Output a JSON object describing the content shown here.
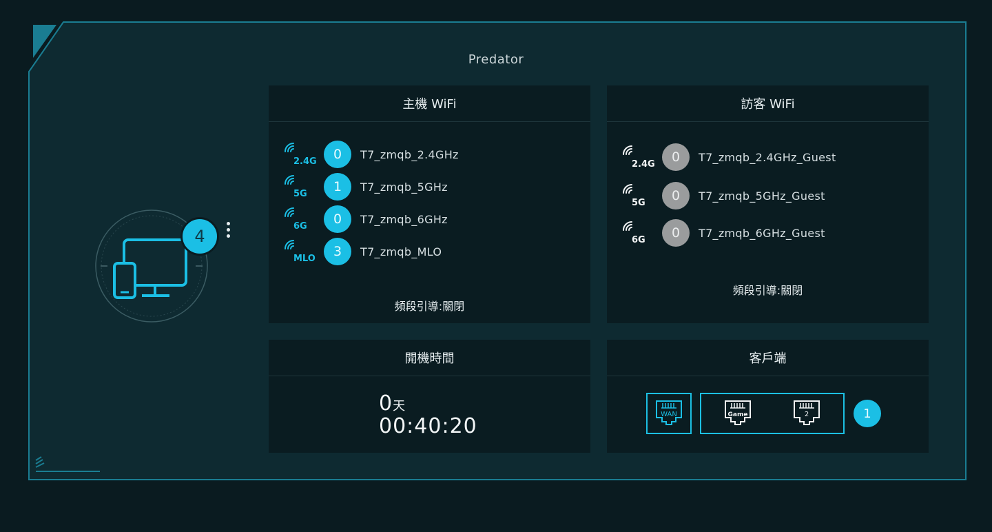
{
  "app": {
    "title": "Predator"
  },
  "devices": {
    "count": "4"
  },
  "main_wifi": {
    "title": "主機 WiFi",
    "networks": [
      {
        "band": "2.4G",
        "count": "0",
        "ssid": "T7_zmqb_2.4GHz"
      },
      {
        "band": "5G",
        "count": "1",
        "ssid": "T7_zmqb_5GHz"
      },
      {
        "band": "6G",
        "count": "0",
        "ssid": "T7_zmqb_6GHz"
      },
      {
        "band": "MLO",
        "count": "3",
        "ssid": "T7_zmqb_MLO"
      }
    ],
    "band_steering": "頻段引導:關閉"
  },
  "guest_wifi": {
    "title": "訪客 WiFi",
    "networks": [
      {
        "band": "2.4G",
        "count": "0",
        "ssid": "T7_zmqb_2.4GHz_Guest"
      },
      {
        "band": "5G",
        "count": "0",
        "ssid": "T7_zmqb_5GHz_Guest"
      },
      {
        "band": "6G",
        "count": "0",
        "ssid": "T7_zmqb_6GHz_Guest"
      }
    ],
    "band_steering": "頻段引導:關閉"
  },
  "uptime": {
    "title": "開機時間",
    "days": "0",
    "days_unit": "天",
    "time": "00:40:20"
  },
  "clients": {
    "title": "客戶端",
    "ports": [
      {
        "label": "WAN",
        "icon": "ethernet-port-icon"
      },
      {
        "label": "Game",
        "icon": "ethernet-port-icon"
      },
      {
        "label": "2",
        "icon": "ethernet-port-icon"
      }
    ],
    "count": "1"
  },
  "colors": {
    "accent": "#1bbfe5",
    "frame": "#1a7d92",
    "inactive": "#9a9c9d",
    "panel": "#0a1c21",
    "main_bg": "#0e2a31"
  }
}
